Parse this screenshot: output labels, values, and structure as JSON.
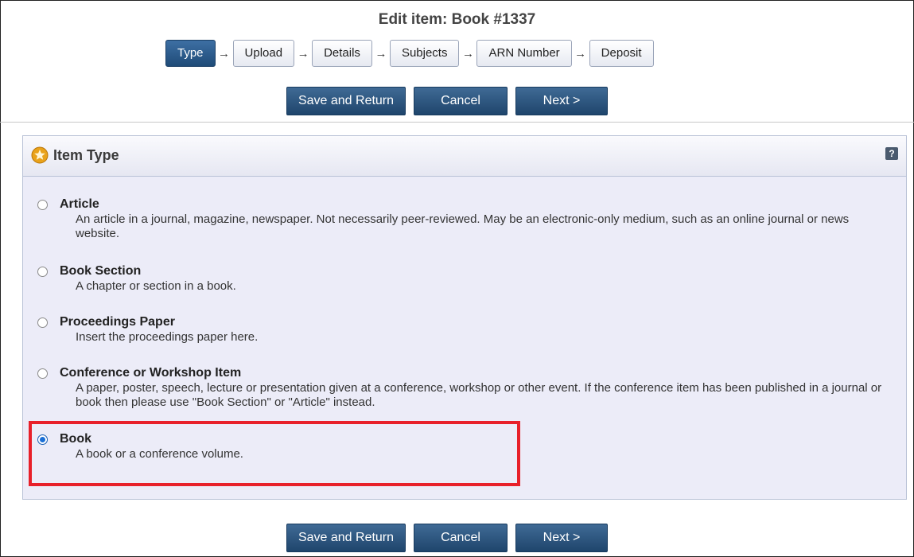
{
  "page": {
    "title": "Edit item: Book #1337"
  },
  "steps": [
    {
      "label": "Type",
      "active": true
    },
    {
      "label": "Upload",
      "active": false
    },
    {
      "label": "Details",
      "active": false
    },
    {
      "label": "Subjects",
      "active": false
    },
    {
      "label": "ARN Number",
      "active": false
    },
    {
      "label": "Deposit",
      "active": false
    }
  ],
  "step_arrow": "→",
  "buttons": {
    "save_return": "Save and Return",
    "cancel": "Cancel",
    "next": "Next >"
  },
  "panel": {
    "title": "Item Type",
    "help": "?"
  },
  "options": [
    {
      "title": "Article",
      "description": "An article in a journal, magazine, newspaper. Not necessarily peer-reviewed. May be an electronic-only medium, such as an online journal or news website.",
      "selected": false
    },
    {
      "title": "Book Section",
      "description": "A chapter or section in a book.",
      "selected": false
    },
    {
      "title": "Proceedings Paper",
      "description": "Insert the proceedings paper here.",
      "selected": false
    },
    {
      "title": "Conference or Workshop Item",
      "description": "A paper, poster, speech, lecture or presentation given at a conference, workshop or other event. If the conference item has been published in a journal or book then please use \"Book Section\" or \"Article\" instead.",
      "selected": false
    },
    {
      "title": "Book",
      "description": "A book or a conference volume.",
      "selected": true
    }
  ],
  "colors": {
    "accent": "#1f4b78",
    "highlight_box": "#e8202a",
    "panel_bg": "#ececf8"
  }
}
